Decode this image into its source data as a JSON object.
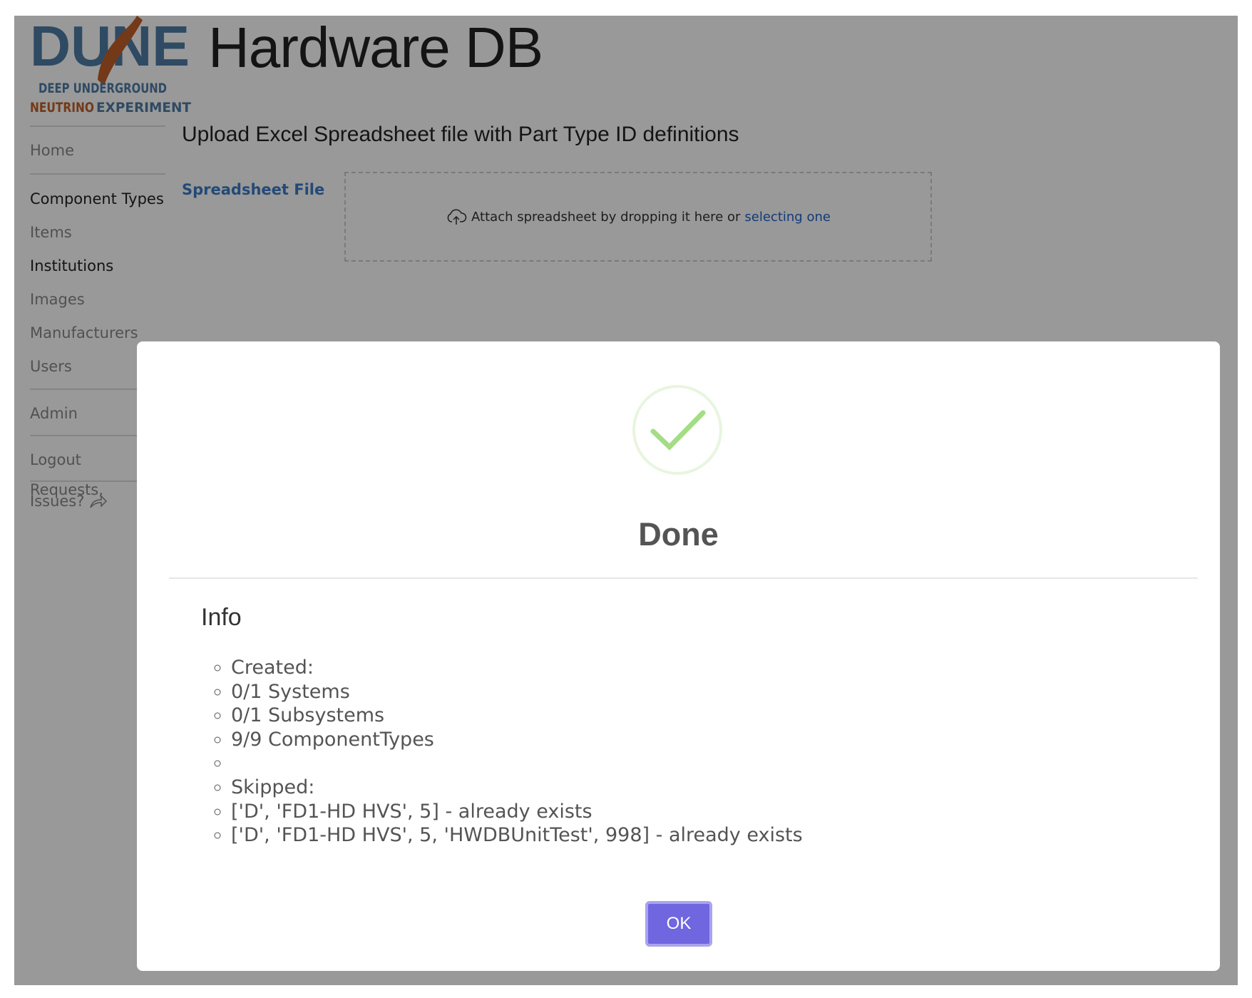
{
  "header": {
    "logo_text": "DUNE",
    "logo_line1": "DEEP UNDERGROUND",
    "logo_line2a": "NEUTRINO",
    "logo_line2b": "EXPERIMENT",
    "title": "Hardware DB"
  },
  "sidebar": {
    "items": [
      {
        "label": "Home"
      },
      {
        "label": "Component Types"
      },
      {
        "label": "Items"
      },
      {
        "label": "Institutions"
      },
      {
        "label": "Images"
      },
      {
        "label": "Manufacturers"
      },
      {
        "label": "Users"
      },
      {
        "label": "Admin"
      },
      {
        "label": "Logout"
      }
    ],
    "requests_line1": "Requests,",
    "requests_line2": "Issues?"
  },
  "main": {
    "heading": "Upload Excel Spreadsheet file with Part Type ID definitions",
    "file_label": "Spreadsheet File",
    "dropzone_text": "Attach spreadsheet by dropping it here or",
    "dropzone_link": "selecting one"
  },
  "modal": {
    "title": "Done",
    "icon": "success-check",
    "info_heading": "Info",
    "items": [
      "Created:",
      "0/1 Systems",
      "0/1 Subsystems",
      "9/9 ComponentTypes",
      "",
      "Skipped:",
      "['D', 'FD1-HD HVS', 5] - already exists",
      "['D', 'FD1-HD HVS', 5, 'HWDBUnitTest', 998] - already exists"
    ],
    "ok_label": "OK"
  },
  "colors": {
    "accent_button": "#7066e0",
    "success": "#a5dc86",
    "link": "#1e62c8",
    "label_blue": "#3c7bc6"
  }
}
